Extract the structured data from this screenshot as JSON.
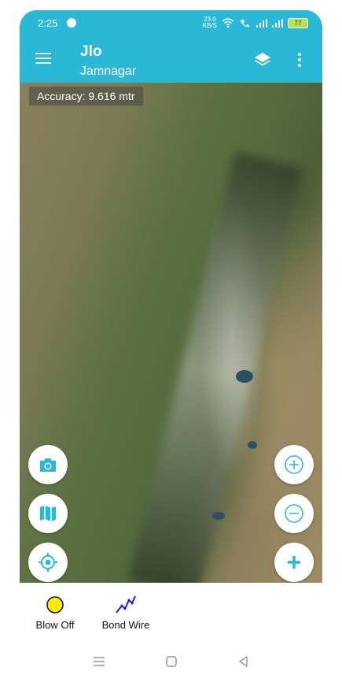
{
  "status_bar": {
    "time": "2:25",
    "speed_value": "23.0",
    "speed_unit": "KB/S",
    "battery": "77"
  },
  "app_bar": {
    "title": "Jlo",
    "subtitle": "Jamnagar"
  },
  "map": {
    "accuracy_text": "Accuracy: 9.616 mtr"
  },
  "legend": {
    "items": [
      {
        "label": "Blow Off",
        "icon": "yellow-circle-icon"
      },
      {
        "label": "Bond Wire",
        "icon": "zigzag-line-icon"
      }
    ]
  },
  "colors": {
    "accent": "#29b9d6",
    "fab_icon": "#29b9d6",
    "blow_off": "#ffeb00",
    "bond_wire": "#1a1aff"
  }
}
